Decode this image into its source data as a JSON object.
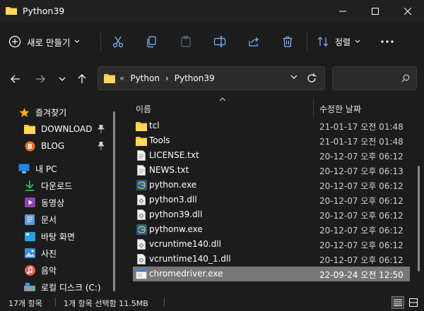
{
  "window": {
    "title": "Python39"
  },
  "toolbar": {
    "new_label": "새로 만들기",
    "sort_label": "정렬"
  },
  "address": {
    "crumbs": [
      "«",
      "Python",
      "›",
      "Python39"
    ],
    "search_placeholder": ""
  },
  "sidebar": {
    "items": [
      {
        "label": "즐겨찾기",
        "icon": "star-icon",
        "pinned": false
      },
      {
        "label": "DOWNLOAD",
        "icon": "folder-icon",
        "pinned": true
      },
      {
        "label": "BLOG",
        "icon": "blog-icon",
        "pinned": true
      },
      {
        "label": "내 PC",
        "icon": "pc-icon",
        "pinned": false
      },
      {
        "label": "다운로드",
        "icon": "download-icon",
        "pinned": false
      },
      {
        "label": "동영상",
        "icon": "video-icon",
        "pinned": false
      },
      {
        "label": "문서",
        "icon": "document-icon",
        "pinned": false
      },
      {
        "label": "바탕 화면",
        "icon": "desktop-icon",
        "pinned": false
      },
      {
        "label": "사진",
        "icon": "pictures-icon",
        "pinned": false
      },
      {
        "label": "음악",
        "icon": "music-icon",
        "pinned": false
      },
      {
        "label": "로컬 디스크 (C:)",
        "icon": "drive-icon",
        "pinned": false
      }
    ]
  },
  "filelist": {
    "col_name": "이름",
    "col_date": "수정한 날짜",
    "rows": [
      {
        "name": "tcl",
        "date": "21-01-17 오전 01:48",
        "icon": "folder-icon"
      },
      {
        "name": "Tools",
        "date": "21-01-17 오전 01:48",
        "icon": "folder-icon"
      },
      {
        "name": "LICENSE.txt",
        "date": "20-12-07 오후 06:12",
        "icon": "text-file-icon"
      },
      {
        "name": "NEWS.txt",
        "date": "20-12-07 오후 06:13",
        "icon": "text-file-icon"
      },
      {
        "name": "python.exe",
        "date": "20-12-07 오후 06:12",
        "icon": "python-icon"
      },
      {
        "name": "python3.dll",
        "date": "20-12-07 오후 06:12",
        "icon": "dll-icon"
      },
      {
        "name": "python39.dll",
        "date": "20-12-07 오후 06:12",
        "icon": "dll-icon"
      },
      {
        "name": "pythonw.exe",
        "date": "20-12-07 오후 06:12",
        "icon": "python-icon"
      },
      {
        "name": "vcruntime140.dll",
        "date": "20-12-07 오후 06:12",
        "icon": "dll-icon"
      },
      {
        "name": "vcruntime140_1.dll",
        "date": "20-12-07 오후 06:12",
        "icon": "dll-icon"
      },
      {
        "name": "chromedriver.exe",
        "date": "22-09-24 오전 12:50",
        "icon": "exe-icon",
        "selected": true
      }
    ]
  },
  "status": {
    "item_count": "17개 항목",
    "selection": "1개 항목 선택함 11.5MB"
  },
  "colors": {
    "folder": "#f4c542",
    "accent": "#60cdff",
    "selected_row": "#777777"
  }
}
